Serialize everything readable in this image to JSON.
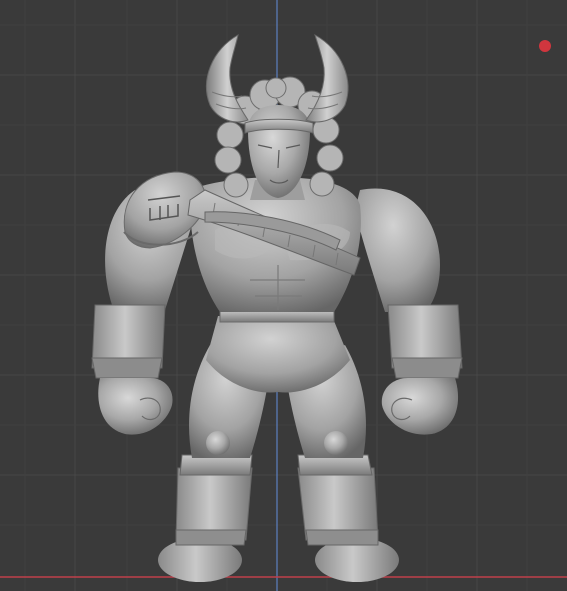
{
  "viewport": {
    "background": "#3a3a3a",
    "grid_color": "#2f2f2f",
    "grid_line_color": "#4a4a4a",
    "axis_z_color": "#5b7fc0",
    "axis_x_color": "#c0404a",
    "indicator_color": "#d0363e",
    "model_base_color": "#a9a9a9",
    "model_shadow_color": "#6e6e6e",
    "model_highlight_color": "#d6d6d6"
  },
  "scene": {
    "object": "sculpt-model-horned-warrior",
    "grid_visible": true,
    "axis_lines_visible": true
  }
}
